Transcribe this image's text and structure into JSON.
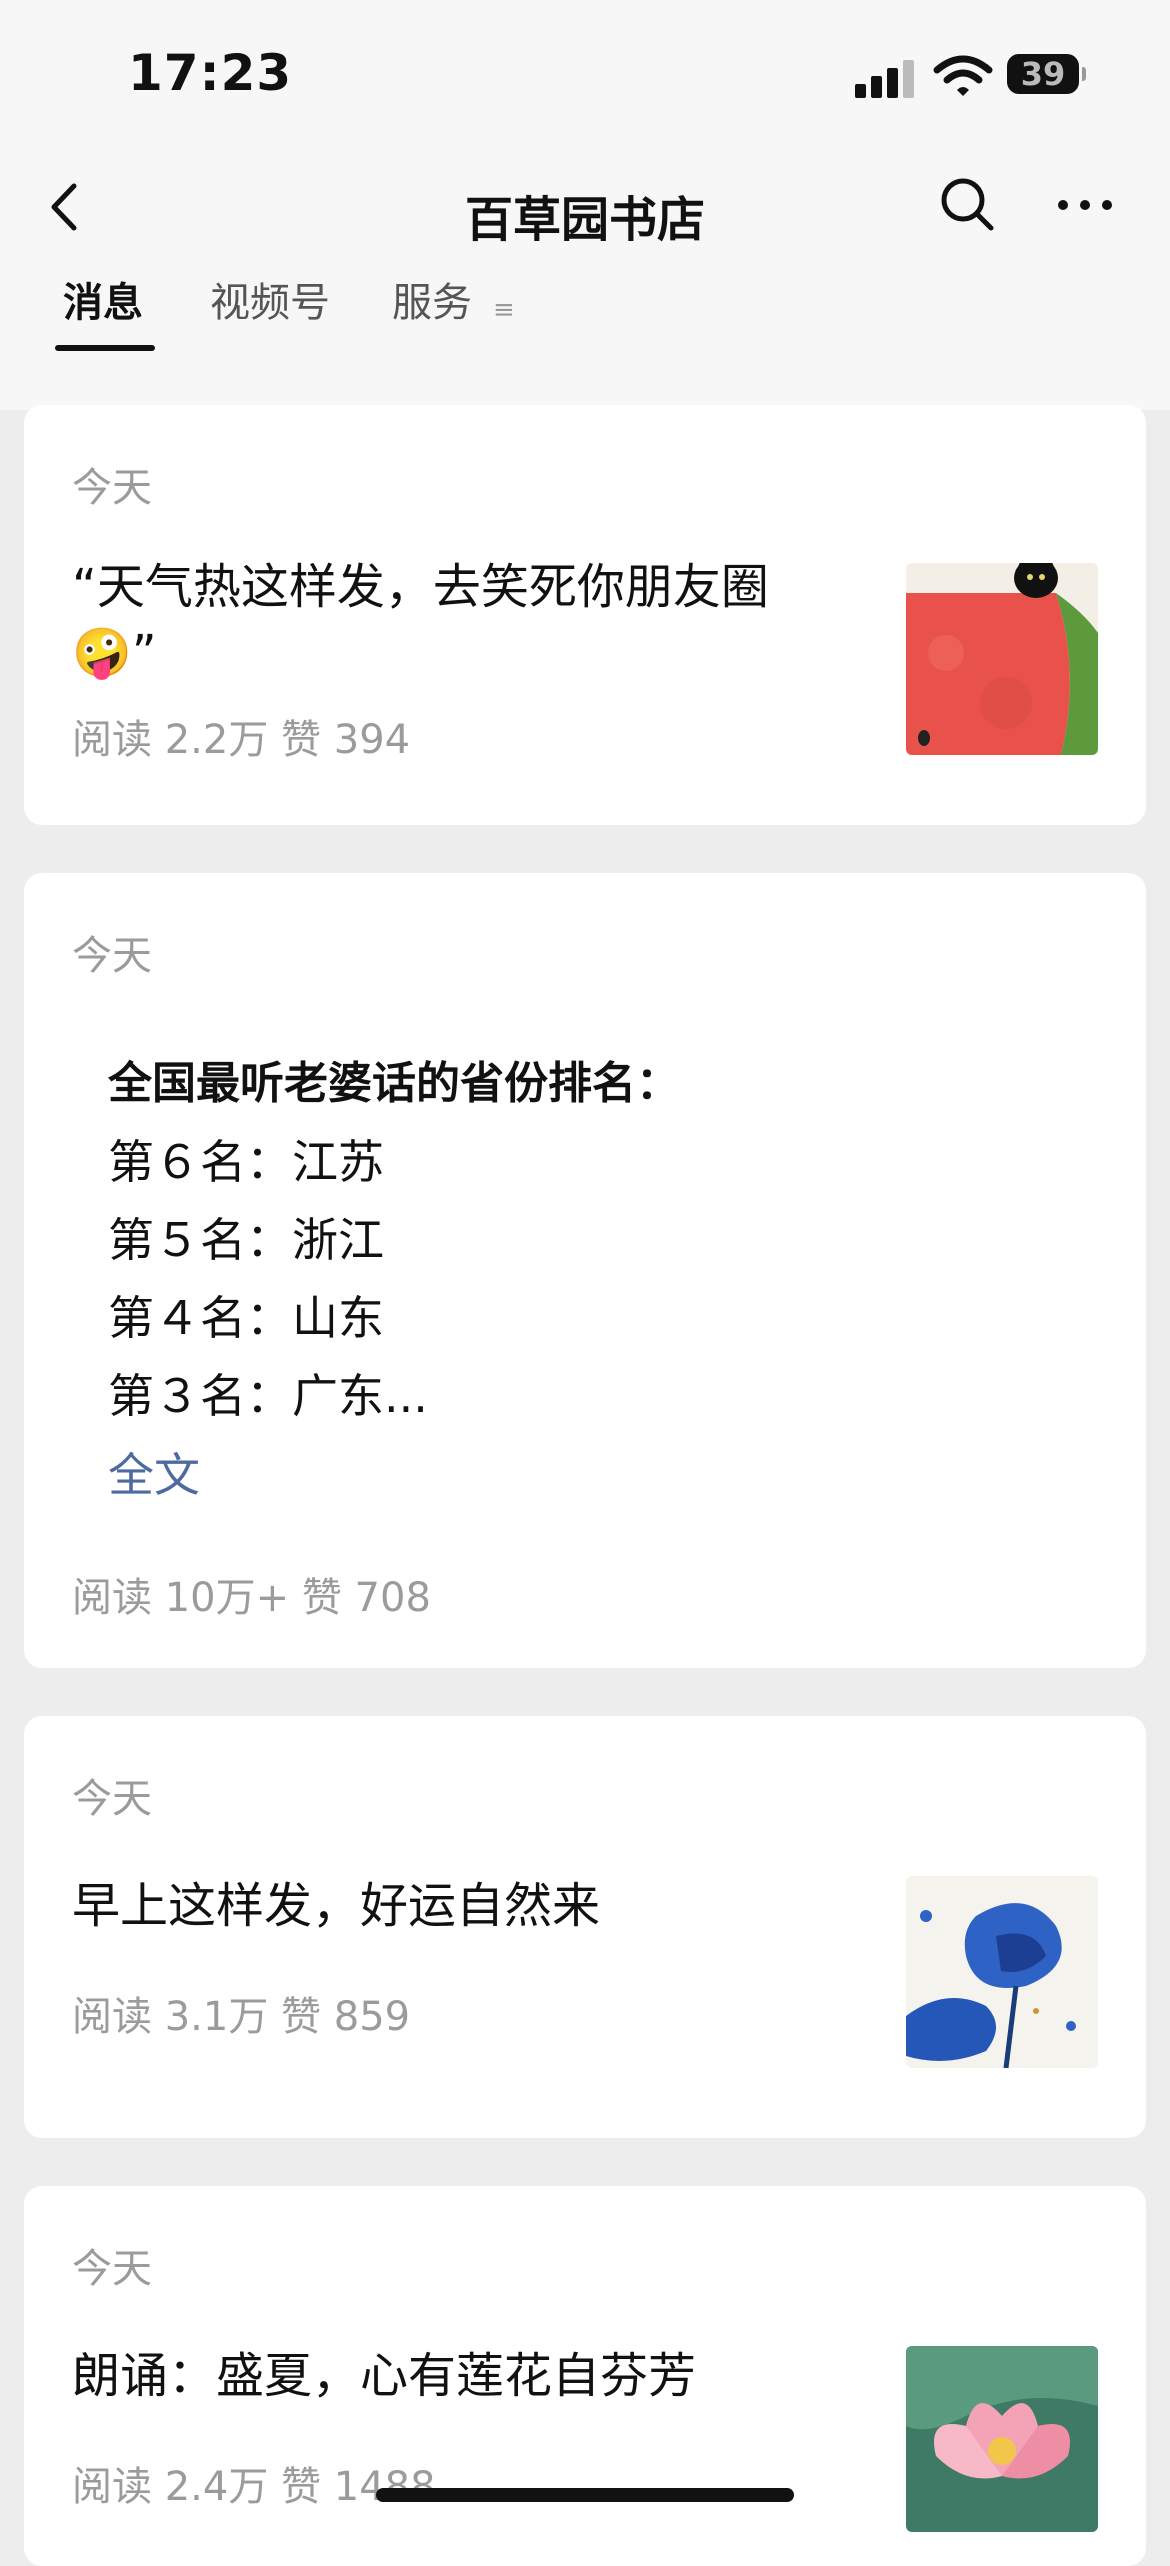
{
  "status_bar": {
    "time": "17:23",
    "battery": "39"
  },
  "header": {
    "title": "百草园书店"
  },
  "tabs": [
    {
      "label": "消息",
      "active": true
    },
    {
      "label": "视频号",
      "active": false
    },
    {
      "label": "服务",
      "active": false
    }
  ],
  "messages": [
    {
      "date": "今天",
      "title_line1": "“天气热这样发，去笑死你朋友圈",
      "title_line2": "🤪”",
      "stats": "阅读 2.2万  赞 394"
    },
    {
      "date": "今天",
      "headline": "全国最听老婆话的省份排名：",
      "lines": [
        "第６名：江苏",
        "第５名：浙江",
        "第４名：山东",
        "第３名：广东..."
      ],
      "full_text_label": "全文",
      "stats": "阅读 10万+  赞 708"
    },
    {
      "date": "今天",
      "title": "早上这样发，好运自然来",
      "stats": "阅读 3.1万  赞 859"
    },
    {
      "date": "今天",
      "title": "朗诵：盛夏，心有莲花自芬芳",
      "stats": "阅读 2.4万  赞 1488"
    }
  ]
}
